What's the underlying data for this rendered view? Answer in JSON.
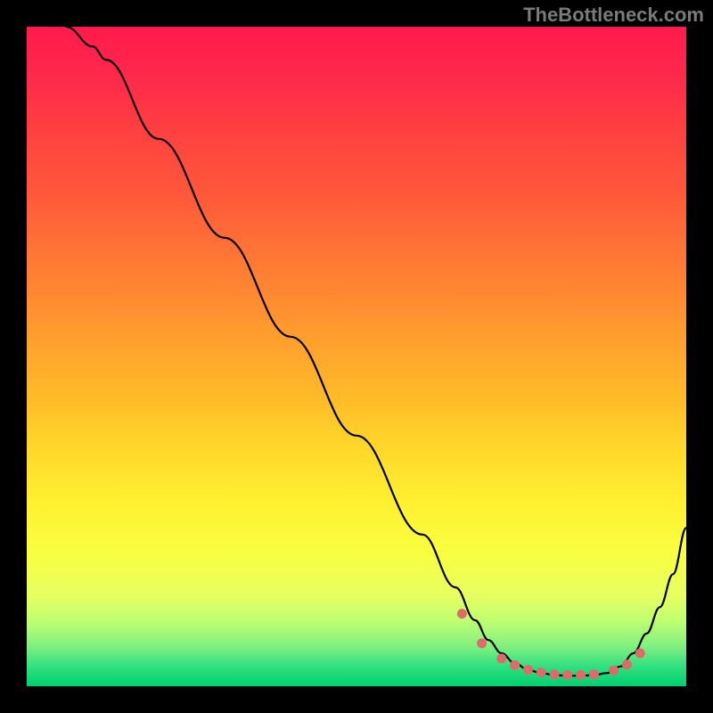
{
  "watermark": "TheBottleneck.com",
  "chart_data": {
    "type": "line",
    "title": "",
    "xlabel": "",
    "ylabel": "",
    "xlim": [
      0,
      100
    ],
    "ylim": [
      0,
      100
    ],
    "series": [
      {
        "name": "curve",
        "x": [
          6,
          10,
          12,
          20,
          30,
          40,
          50,
          60,
          65,
          68,
          70,
          72,
          74,
          76,
          78,
          80,
          82,
          84,
          86,
          88,
          90,
          92,
          94,
          96,
          98,
          100
        ],
        "y": [
          100,
          97,
          95,
          83,
          68,
          53,
          38,
          23,
          15,
          10,
          7,
          5,
          3.5,
          2.5,
          2,
          1.7,
          1.6,
          1.6,
          1.7,
          2,
          3,
          5,
          8,
          12,
          17,
          24
        ]
      }
    ],
    "markers": {
      "name": "dots",
      "x": [
        66,
        69,
        72,
        74,
        76,
        78,
        80,
        82,
        84,
        86,
        89,
        91,
        93
      ],
      "y": [
        11,
        6.5,
        4.2,
        3.2,
        2.5,
        2.1,
        1.8,
        1.7,
        1.7,
        1.8,
        2.4,
        3.3,
        5.0
      ]
    },
    "colors": {
      "gradient_top": "#ff1a4d",
      "gradient_mid": "#ffd82a",
      "gradient_bottom": "#00d070",
      "curve": "#000000",
      "markers": "#e06a6a",
      "background": "#000000"
    }
  }
}
